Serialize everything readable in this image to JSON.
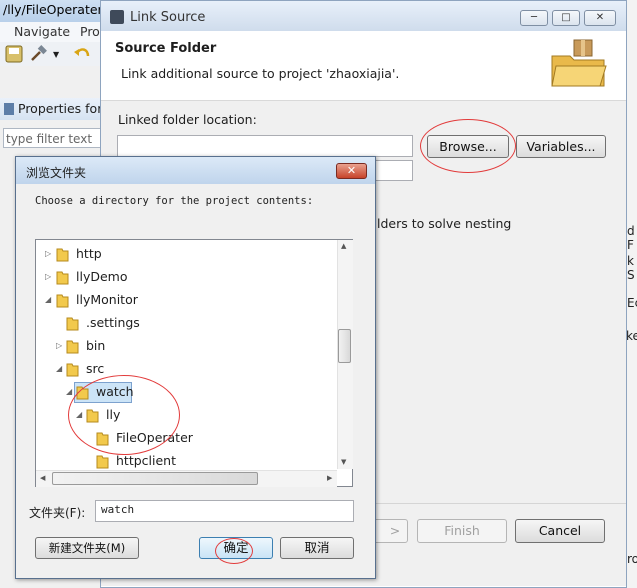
{
  "background_window": {
    "title": "/lly/FileOperater",
    "menu": [
      "Navigate",
      "Pro"
    ],
    "properties_tab": "Properties for",
    "filter_placeholder": "type filter text",
    "right_edge_labels": [
      "d F",
      "k S",
      "Ec",
      "ker",
      "ro"
    ]
  },
  "link_source_dialog": {
    "title": "Link Source",
    "header_title": "Source Folder",
    "header_description": "Link additional source to project 'zhaoxiajia'.",
    "linked_folder_label": "Linked folder location:",
    "linked_folder_value": "",
    "browse_label": "Browse...",
    "variables_label": "Variables...",
    "nesting_text": "lders to solve nesting",
    "finish_label": "Finish",
    "cancel_label": "Cancel",
    "window_buttons": [
      "─",
      "□",
      "✕"
    ]
  },
  "browse_dialog": {
    "title": "浏览文件夹",
    "close_glyph": "✕",
    "description": "Choose a directory for the project contents:",
    "tree": [
      {
        "label": "http",
        "expander": "collapsed",
        "selected": false
      },
      {
        "label": "llyDemo",
        "expander": "collapsed",
        "selected": false
      },
      {
        "label": "llyMonitor",
        "expander": "expanded",
        "selected": false
      },
      {
        "label": ".settings",
        "expander": "none",
        "selected": false
      },
      {
        "label": "bin",
        "expander": "collapsed",
        "selected": false
      },
      {
        "label": "src",
        "expander": "expanded",
        "selected": false
      },
      {
        "label": "watch",
        "expander": "expanded",
        "selected": true
      },
      {
        "label": "lly",
        "expander": "expanded",
        "selected": false
      },
      {
        "label": "FileOperater",
        "expander": "none",
        "selected": false
      },
      {
        "label": "httpclient",
        "expander": "none",
        "selected": false
      }
    ],
    "folder_label": "文件夹(F):",
    "folder_value": "watch",
    "new_folder_label": "新建文件夹(M)",
    "ok_label": "确定",
    "cancel_label": "取消"
  },
  "colors": {
    "annotation_red": "#e23b3b",
    "folder_yellow": "#f2c94c",
    "selection_blue": "#cce4f7"
  }
}
